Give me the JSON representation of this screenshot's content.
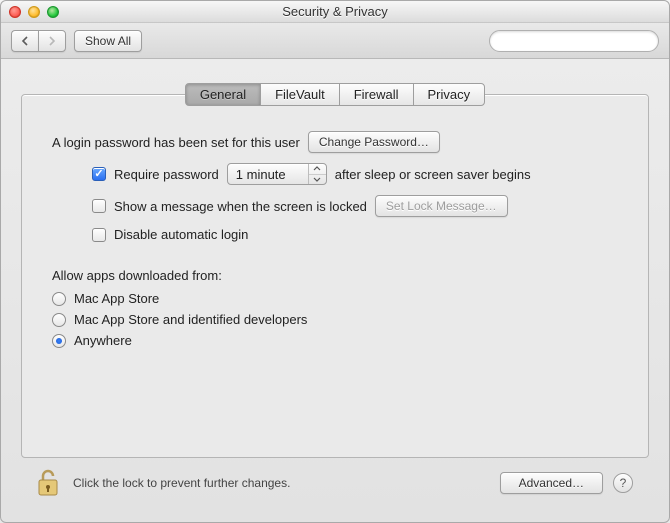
{
  "window": {
    "title": "Security & Privacy"
  },
  "toolbar": {
    "show_all": "Show All",
    "search_placeholder": ""
  },
  "tabs": [
    "General",
    "FileVault",
    "Firewall",
    "Privacy"
  ],
  "active_tab": "General",
  "general": {
    "login_password_msg": "A login password has been set for this user",
    "change_password_btn": "Change Password…",
    "require_password": {
      "checked": true,
      "label_before": "Require password",
      "delay": "1 minute",
      "label_after": "after sleep or screen saver begins"
    },
    "show_message": {
      "checked": false,
      "label": "Show a message when the screen is locked",
      "set_btn": "Set Lock Message…"
    },
    "disable_auto_login": {
      "checked": false,
      "label": "Disable automatic login"
    },
    "gatekeeper": {
      "heading": "Allow apps downloaded from:",
      "options": [
        "Mac App Store",
        "Mac App Store and identified developers",
        "Anywhere"
      ],
      "selected": "Anywhere"
    }
  },
  "footer": {
    "lock_msg": "Click the lock to prevent further changes.",
    "advanced_btn": "Advanced…",
    "help": "?"
  }
}
